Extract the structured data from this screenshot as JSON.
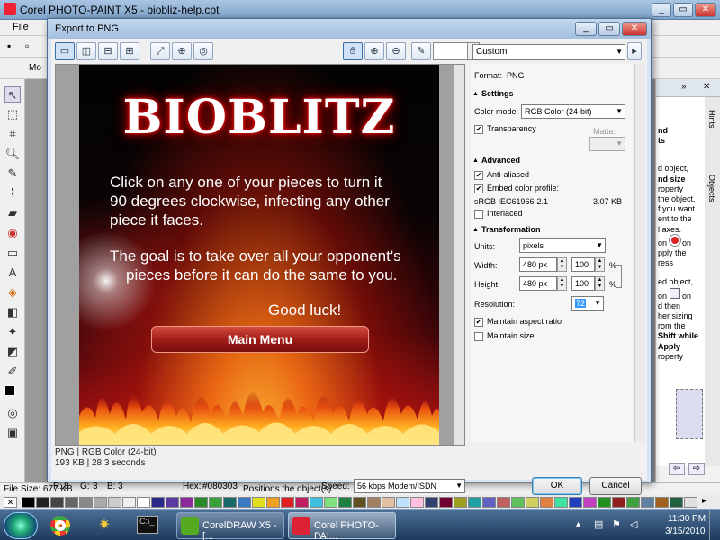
{
  "app": {
    "title": "Corel PHOTO-PAINT X5 - biobliz-help.cpt",
    "menu_file": "File",
    "prop_label": "Mo"
  },
  "dialog": {
    "title": "Export to PNG",
    "preset": "Custom",
    "format_label": "Format:",
    "format_value": "PNG",
    "settings_header": "Settings",
    "color_mode_label": "Color mode:",
    "color_mode_value": "RGB Color (24-bit)",
    "transparency_label": "Transparency",
    "transparency_checked": true,
    "matte_label": "Matte:",
    "advanced_header": "Advanced",
    "anti_aliased_label": "Anti-aliased",
    "anti_aliased_checked": true,
    "embed_profile_label": "Embed color profile:",
    "embed_profile_checked": true,
    "profile_name": "sRGB IEC61966-2.1",
    "profile_size": "3.07 KB",
    "interlaced_label": "Interlaced",
    "interlaced_checked": false,
    "transformation_header": "Transformation",
    "units_label": "Units:",
    "units_value": "pixels",
    "width_label": "Width:",
    "width_value": "480 px",
    "width_pct": "100",
    "height_label": "Height:",
    "height_value": "480 px",
    "height_pct": "100",
    "pct_symbol": "%",
    "resolution_label": "Resolution:",
    "resolution_value": "72",
    "maintain_aspect_label": "Maintain aspect ratio",
    "maintain_aspect_checked": true,
    "maintain_size_label": "Maintain size",
    "maintain_size_checked": false,
    "preview_info_line1": "PNG  |  RGB Color (24-bit)",
    "preview_info_line2": "193 KB  |  28.3 seconds",
    "r_label": "R:",
    "r_value": "8",
    "g_label": "G:",
    "g_value": "3",
    "b_label": "B:",
    "b_value": "3",
    "hex_label": "Hex:",
    "hex_value": "#080303",
    "speed_label": "Speed:",
    "speed_value": "56 kbps Modem/ISDN",
    "ok_label": "OK",
    "cancel_label": "Cancel"
  },
  "game": {
    "logo": "BIOBLITZ",
    "para1_line1": "Click on any one of your pieces to turn it",
    "para1_line2": "90 degrees clockwise, infecting any other",
    "para1_line3": "piece it faces.",
    "para2_line1": "The goal is to take over all your opponent's",
    "para2_line2": "pieces before it can do the same to you.",
    "good_luck": "Good luck!",
    "main_menu": "Main Menu"
  },
  "docker": {
    "hints_tab": "Hints",
    "objects_tab": "Objects",
    "lines": [
      "nd",
      "ts",
      "d object,",
      "nd size",
      "roperty",
      "the object,",
      "f you want",
      "ent to the",
      "l axes.",
      "on",
      "on",
      "pply the",
      "ress",
      "ed object,",
      "on",
      "on",
      "d then",
      "her sizing",
      "rom the",
      "Shift while",
      "Apply",
      "roperty"
    ]
  },
  "status": {
    "file_size": "File Size: 677 KB",
    "hint": "Positions the object(s)"
  },
  "taskbar": {
    "corel_draw": "CorelDRAW X5 - [...",
    "photo_paint": "Corel PHOTO-PAI...",
    "time": "11:30 PM",
    "date": "3/15/2010"
  },
  "colors": {
    "dialog_bg": "#d6e4f3",
    "accent": "#3399ff",
    "button_red": "#b0221b"
  }
}
